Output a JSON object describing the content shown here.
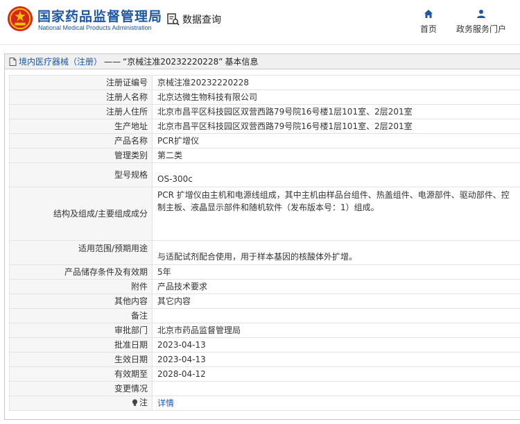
{
  "header": {
    "brand_cn": "国家药品监督管理局",
    "brand_en": "National Medical Products Administration",
    "query_label": "数据查询",
    "nav": [
      {
        "label": "首页",
        "icon": "home-icon"
      },
      {
        "label": "政务服务门户",
        "icon": "user-icon"
      }
    ]
  },
  "colors": {
    "brand": "#1c57a6",
    "logo_red": "#d7261e",
    "label_bg": "#f6f6f6"
  },
  "panel": {
    "title_prefix": "境内医疗器械（注册）",
    "title_sep": "——",
    "title_reg": "“京械注准20232220228”",
    "title_suffix": "基本信息"
  },
  "rows": [
    {
      "label": "注册证编号",
      "value": "京械注准20232220228"
    },
    {
      "label": "注册人名称",
      "value": "北京达微生物科技有限公司"
    },
    {
      "label": "注册人住所",
      "value": "北京市昌平区科技园区双营西路79号院16号楼1层101室、2层201室"
    },
    {
      "label": "生产地址",
      "value": "北京市昌平区科技园区双营西路79号院16号楼1层101室、2层201室"
    },
    {
      "label": "产品名称",
      "value": "PCR扩增仪"
    },
    {
      "label": "管理类别",
      "value": "第二类"
    },
    {
      "label": "型号规格",
      "value": "OS-300c"
    },
    {
      "label": "结构及组成/主要组成成分",
      "value": "PCR 扩增仪由主机和电源线组成，其中主机由样品台组件、热盖组件、电源部件、驱动部件、控制主板、液晶显示部件和随机软件（发布版本号：1）组成。"
    },
    {
      "label": "适用范围/预期用途",
      "value": "与适配试剂配合使用，用于样本基因的核酸体外扩增。"
    },
    {
      "label": "产品储存条件及有效期",
      "value": "5年"
    },
    {
      "label": "附件",
      "value": "产品技术要求"
    },
    {
      "label": "其他内容",
      "value": "其它内容"
    },
    {
      "label": "备注",
      "value": ""
    },
    {
      "label": "审批部门",
      "value": "北京市药品监督管理局"
    },
    {
      "label": "批准日期",
      "value": "2023-04-13"
    },
    {
      "label": "生效日期",
      "value": "2023-04-13"
    },
    {
      "label": "有效期至",
      "value": "2028-04-12"
    },
    {
      "label": "变更情况",
      "value": ""
    },
    {
      "label": "注",
      "value": "详情"
    }
  ]
}
